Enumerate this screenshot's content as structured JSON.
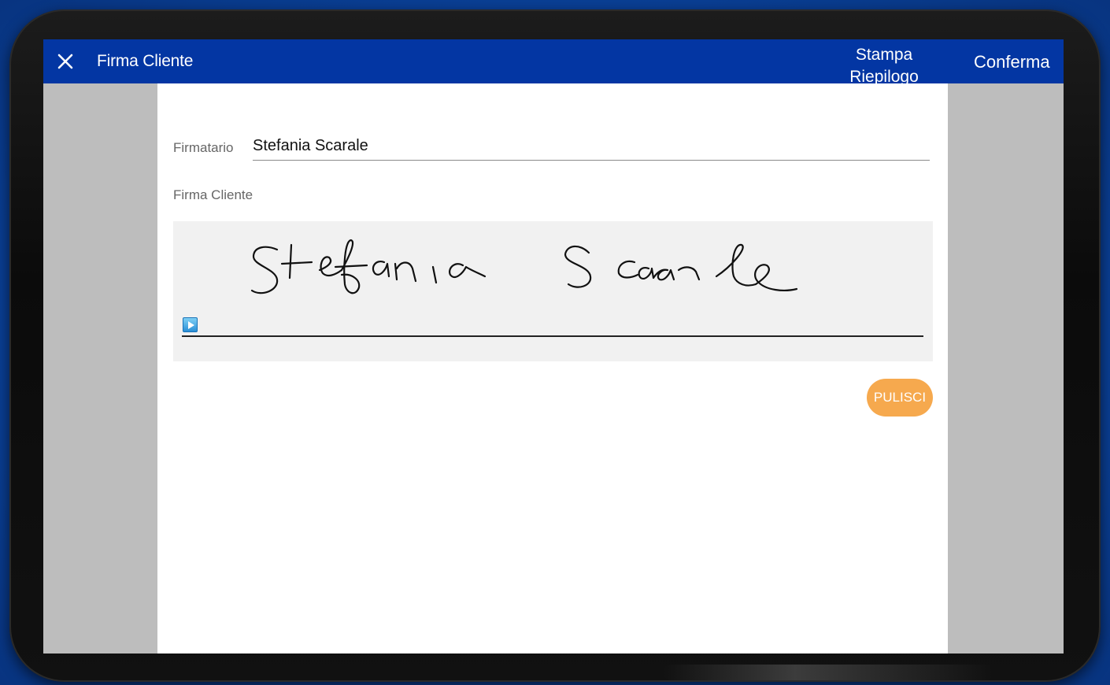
{
  "appbar": {
    "close_icon": "close-icon",
    "title": "Firma Cliente",
    "stampa_line1": "Stampa",
    "stampa_line2": "Riepilogo",
    "confirm_label": "Conferma",
    "color": "#0336a3"
  },
  "form": {
    "signer_label": "Firmatario",
    "signer_value": "Stefania Scarale",
    "signature_label": "Firma Cliente",
    "signature_icon": "play-icon",
    "clear_label": "PULISCI",
    "clear_color": "#f6a94e"
  }
}
